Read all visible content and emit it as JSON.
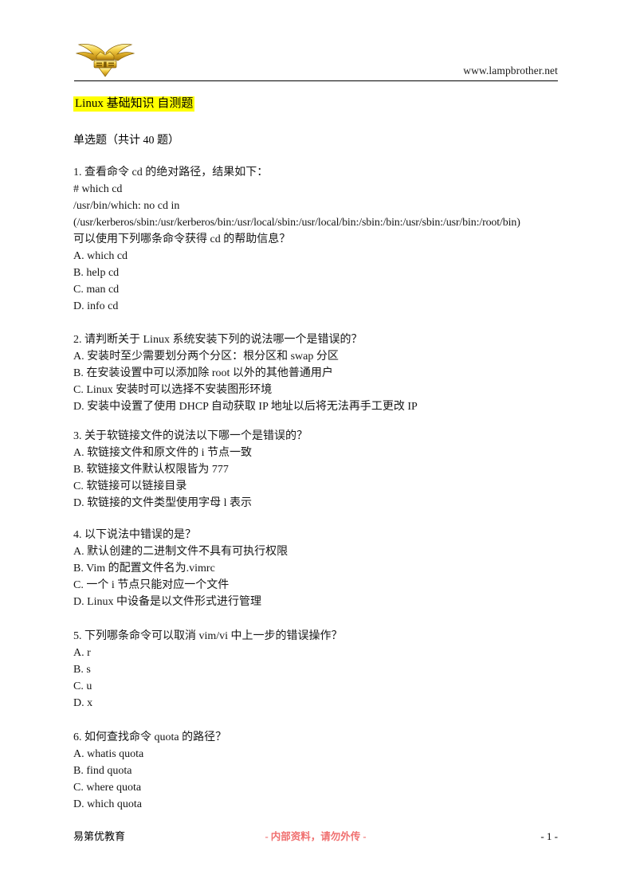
{
  "header": {
    "logo_alt": "lampbrother-winged-logo",
    "url": "www.lampbrother.net"
  },
  "title": {
    "text": "Linux 基础知识 自测题",
    "highlight_color": "#ffff00"
  },
  "section_label": "单选题（共计 40 题）",
  "questions": [
    {
      "number": "1",
      "lines": [
        "1. 查看命令 cd 的绝对路径，结果如下：",
        "# which cd",
        "/usr/bin/which: no cd in",
        "(/usr/kerberos/sbin:/usr/kerberos/bin:/usr/local/sbin:/usr/local/bin:/sbin:/bin:/usr/sbin:/usr/bin:/root/bin)",
        "可以使用下列哪条命令获得 cd 的帮助信息？",
        "A. which cd",
        "B. help cd",
        "C. man cd",
        "D. info cd"
      ]
    },
    {
      "number": "2",
      "lines": [
        "2. 请判断关于 Linux 系统安装下列的说法哪一个是错误的？",
        "A. 安装时至少需要划分两个分区：根分区和 swap 分区",
        "B. 在安装设置中可以添加除 root 以外的其他普通用户",
        "C. Linux 安装时可以选择不安装图形环境",
        "D. 安装中设置了使用 DHCP 自动获取 IP 地址以后将无法再手工更改 IP"
      ]
    },
    {
      "number": "3",
      "lines": [
        "3. 关于软链接文件的说法以下哪一个是错误的？",
        "A. 软链接文件和原文件的 i 节点一致",
        "B. 软链接文件默认权限皆为 777",
        "C. 软链接可以链接目录",
        "D. 软链接的文件类型使用字母 l 表示"
      ]
    },
    {
      "number": "4",
      "lines": [
        "4. 以下说法中错误的是？",
        "A. 默认创建的二进制文件不具有可执行权限",
        "B. Vim 的配置文件名为.vimrc",
        "C. 一个 i 节点只能对应一个文件",
        "D. Linux 中设备是以文件形式进行管理"
      ]
    },
    {
      "number": "5",
      "lines": [
        "5. 下列哪条命令可以取消 vim/vi 中上一步的错误操作？",
        "A. r",
        "B. s",
        "C. u",
        "D. x"
      ]
    },
    {
      "number": "6",
      "lines": [
        "6. 如何查找命令 quota 的路径？",
        "A. whatis quota",
        "B. find quota",
        "C. where quota",
        "D. which quota"
      ]
    }
  ],
  "footer": {
    "left": "易第优教育",
    "center": "- 内部资料，请勿外传 -",
    "center_color": "#f07070",
    "page_number": "- 1 -"
  }
}
